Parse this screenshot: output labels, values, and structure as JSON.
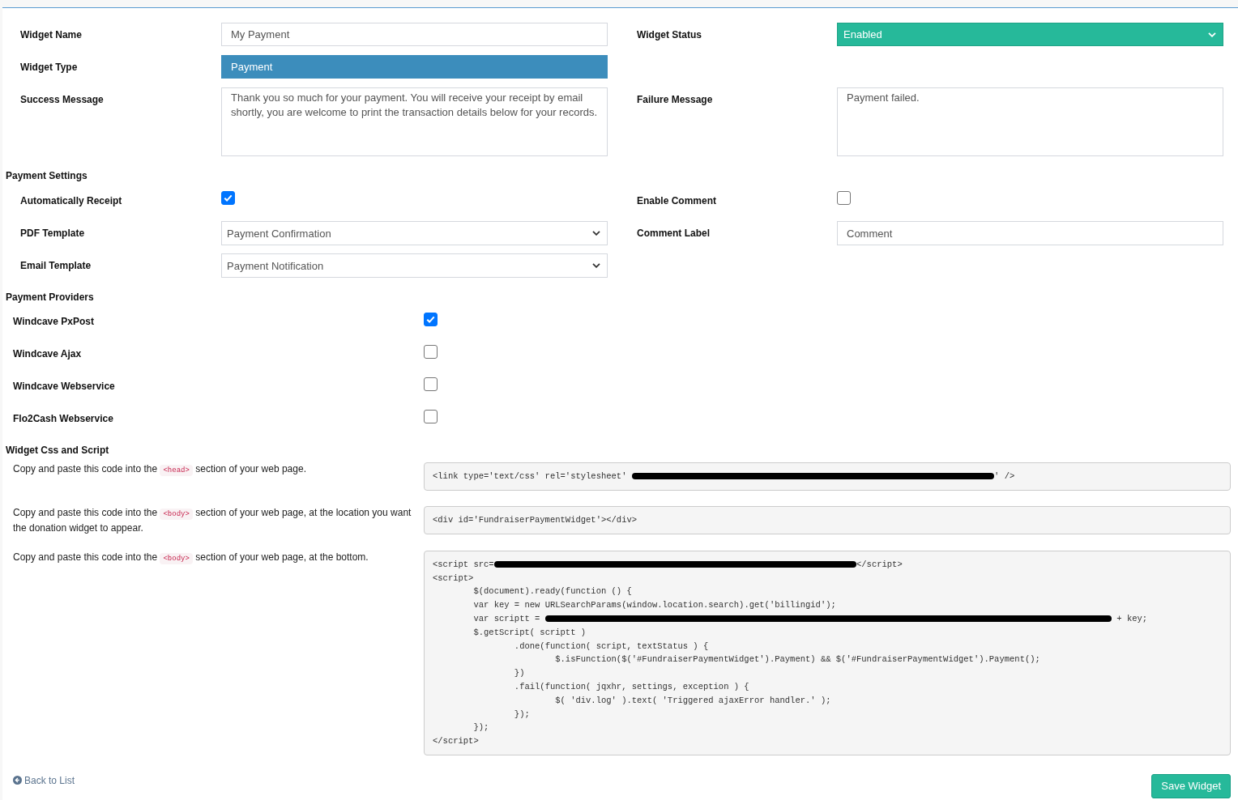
{
  "general": [
    [
      {
        "label": "Widget Name",
        "kind": "input",
        "value": "My Payment"
      },
      {
        "label": "Widget Status",
        "kind": "status",
        "value": "Enabled"
      }
    ],
    [
      {
        "label": "Widget Type",
        "kind": "display",
        "value": "Payment"
      }
    ],
    [
      {
        "label": "Success Message",
        "kind": "textarea",
        "value": "Thank you so much for your payment. You will receive your receipt by email shortly, you are welcome to print the transaction details below for your records."
      },
      {
        "label": "Failure Message",
        "kind": "textarea",
        "value": "Payment failed."
      }
    ]
  ],
  "payment_settings": {
    "title": "Payment Settings",
    "rows": [
      [
        {
          "label": "Automatically Receipt",
          "kind": "checkbox",
          "checked": true
        },
        {
          "label": "Enable Comment",
          "kind": "checkbox",
          "checked": false
        }
      ],
      [
        {
          "label": "PDF Template",
          "kind": "select",
          "value": "Payment Confirmation"
        },
        {
          "label": "Comment Label",
          "kind": "input",
          "value": "Comment"
        }
      ],
      [
        {
          "label": "Email Template",
          "kind": "select",
          "value": "Payment Notification"
        }
      ]
    ]
  },
  "payment_providers": {
    "title": "Payment Providers",
    "items": [
      {
        "label": "Windcave PxPost",
        "checked": true
      },
      {
        "label": "Windcave Ajax",
        "checked": false
      },
      {
        "label": "Windcave Webservice",
        "checked": false
      },
      {
        "label": "Flo2Cash Webservice",
        "checked": false
      }
    ]
  },
  "css_and_script": {
    "title": "Widget Css and Script",
    "snippets": [
      {
        "before": "Copy and paste this code into the",
        "tag": "<head>",
        "after": "section of your web page.",
        "code": [
          [
            {
              "kind": "text",
              "text": "<link type='text/css' rel='stylesheet' "
            },
            {
              "kind": "redacted"
            },
            {
              "kind": "text",
              "text": "' />"
            }
          ]
        ]
      },
      {
        "before": "Copy and paste this code into the",
        "tag": "<body>",
        "after": "section of your web page, at the location you want the donation widget to appear.",
        "code": [
          [
            {
              "kind": "text",
              "text": "<div id='FundraiserPaymentWidget'></div>"
            }
          ]
        ]
      },
      {
        "before": "Copy and paste this code into the",
        "tag": "<body>",
        "after": "section of your web page, at the bottom.",
        "code": [
          [
            {
              "kind": "text",
              "text": "<script src="
            },
            {
              "kind": "redacted"
            },
            {
              "kind": "text",
              "text": "</script>"
            }
          ],
          [
            {
              "kind": "text",
              "text": "<script>"
            }
          ],
          [
            {
              "kind": "text",
              "text": "\t$(document).ready(function () {"
            }
          ],
          [
            {
              "kind": "text",
              "text": "\tvar key = new URLSearchParams(window.location.search).get('billingid');"
            }
          ],
          [
            {
              "kind": "text",
              "text": "\tvar scriptt = "
            },
            {
              "kind": "redacted"
            },
            {
              "kind": "text",
              "text": " + key;"
            }
          ],
          [
            {
              "kind": "text",
              "text": "\t$.getScript( scriptt )"
            }
          ],
          [
            {
              "kind": "text",
              "text": "\t\t.done(function( script, textStatus ) {"
            }
          ],
          [
            {
              "kind": "text",
              "text": "\t\t\t$.isFunction($('#FundraiserPaymentWidget').Payment) && $('#FundraiserPaymentWidget').Payment();"
            }
          ],
          [
            {
              "kind": "text",
              "text": "\t\t})"
            }
          ],
          [
            {
              "kind": "text",
              "text": "\t\t.fail(function( jqxhr, settings, exception ) {"
            }
          ],
          [
            {
              "kind": "text",
              "text": "\t\t\t$( 'div.log' ).text( 'Triggered ajaxError handler.' );"
            }
          ],
          [
            {
              "kind": "text",
              "text": "\t\t});"
            }
          ],
          [
            {
              "kind": "text",
              "text": "\t});"
            }
          ],
          [
            {
              "kind": "text",
              "text": "</script>"
            }
          ]
        ]
      }
    ]
  },
  "footer": {
    "back_link": "Back to List",
    "save_button": "Save Widget"
  }
}
